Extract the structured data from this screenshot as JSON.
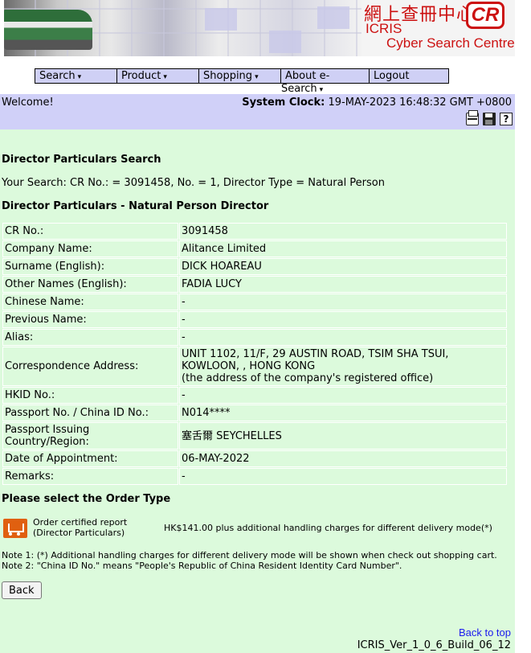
{
  "banner": {
    "title_chinese": "網上查冊中心",
    "logo_text": "CR",
    "brand": "ICRIS",
    "subtitle": "Cyber Search Centre"
  },
  "menu": {
    "items": [
      {
        "label": "Search",
        "caret": "▾"
      },
      {
        "label": "Product",
        "caret": "▾"
      },
      {
        "label": "Shopping",
        "caret": "▾"
      },
      {
        "label_line1": "About e-",
        "label_line2": "Search",
        "caret": "▾"
      },
      {
        "label": "Logout"
      }
    ]
  },
  "welcome": {
    "text": "Welcome!",
    "clock_label": "System Clock:",
    "clock_value": "19-MAY-2023 16:48:32 GMT +0800",
    "icons": [
      "print-icon",
      "save-icon",
      "help-icon"
    ]
  },
  "main": {
    "search_heading": "Director Particulars Search",
    "your_search": "Your Search: CR No.: = 3091458, No. = 1, Director Type = Natural Person",
    "director_heading": "Director Particulars - Natural Person Director",
    "details": [
      {
        "label": "CR No.:",
        "value": "3091458"
      },
      {
        "label": "Company Name:",
        "value": "Alitance Limited"
      },
      {
        "label": "Surname (English):",
        "value": "DICK HOAREAU"
      },
      {
        "label": "Other Names (English):",
        "value": "FADIA LUCY"
      },
      {
        "label": "Chinese Name:",
        "value": "-"
      },
      {
        "label": "Previous Name:",
        "value": "-"
      },
      {
        "label": "Alias:",
        "value": "-"
      },
      {
        "label": "Correspondence Address:",
        "value_line1": "UNIT 1102, 11/F, 29 AUSTIN ROAD, TSIM SHA TSUI,",
        "value_line2": "KOWLOON, , HONG KONG",
        "value_line3": "(the address of the company's registered office)"
      },
      {
        "label": "HKID No.:",
        "value": "-"
      },
      {
        "label": "Passport No. / China ID No.:",
        "value": "N014****"
      },
      {
        "label_line1": "Passport Issuing",
        "label_line2": "Country/Region:",
        "value": "塞舌爾 SEYCHELLES"
      },
      {
        "label": "Date of Appointment:",
        "value": "06-MAY-2022"
      },
      {
        "label": "Remarks:",
        "value": "-"
      }
    ],
    "order_heading": "Please select the Order Type",
    "order": {
      "label_line1": "Order certified report",
      "label_line2": "(Director Particulars)",
      "price": "HK$141.00 plus additional handling charges for different delivery mode(*)"
    },
    "notes": [
      "Note 1: (*) Additional handling charges for different delivery mode will be shown when check out shopping cart.",
      "Note 2: \"China ID No.\" means \"People's Republic of China Resident Identity Card Number\"."
    ],
    "back_button": "Back",
    "back_to_top": "Back to top",
    "version": "ICRIS_Ver_1_0_6_Build_06_12"
  },
  "colors": {
    "menu_bg": "#cfd0f5",
    "welcome_bg": "#d0d0f8",
    "content_bg": "#dcfadc",
    "brand_red": "#cc1111",
    "link_blue": "#1a1aee"
  }
}
